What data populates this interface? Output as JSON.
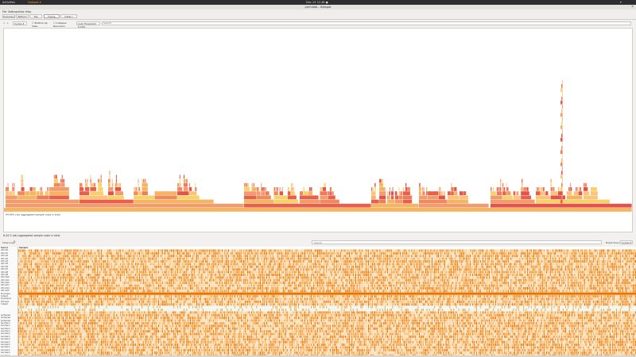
{
  "topbar": {
    "activities": "Activities",
    "app": "Hotspot ▾",
    "clock": "Dec 15 12:48 ●"
  },
  "window": {
    "title": "perf.data - Hotspot"
  },
  "menu": [
    "File",
    "Settings",
    "View",
    "Help"
  ],
  "tabs": [
    "Summary",
    "Bottom Up",
    "Top Down",
    "Flame Graph",
    "Caller / Callee"
  ],
  "active_tab": "Flame Graph",
  "toolbar": {
    "metric": "Cycles",
    "bottom_up": "Bottom Up View",
    "collapse": "Collapse Recursion",
    "cost_threshold": "Cost Threshold: 0.10%",
    "search_placeholder": "Search"
  },
  "flame": {
    "root_label": "94.49% (ok) aggregated sample costs in total",
    "colors": [
      "#e8604c",
      "#f08a5d",
      "#f5b461",
      "#f7d26a",
      "#ee7b5a",
      "#f39c6b",
      "#ffc27a",
      "#e4524a"
    ]
  },
  "timeline": {
    "info": "8.44 G (ok) aggregated sample costs in total",
    "time_line_label": "Time Line",
    "search_placeholder": "Search",
    "event_source_label": "Event Source:",
    "event_source_value": "Cycles",
    "header_source": "Source",
    "header_samples": "Samples",
    "rows": [
      "CPU #0",
      "CPU #1",
      "CPU #2",
      "CPU #3",
      "CPU #4",
      "CPU #5",
      "CPU #6",
      "CPU #7",
      "CPU #8",
      "CPU #9",
      "CPU #10",
      "CPU #11",
      "CPU #12",
      "CPU #13",
      "CPU #14",
      "CPU #15",
      "Processes",
      "hotspot",
      "threadpool",
      "QThread",
      "hotspot",
      "",
      "",
      "",
      "perfparser",
      "perfparser",
      "perfparser",
      "kworker/u",
      "kworker/u",
      "kworker/u",
      "kworker/u",
      "kworker/u",
      "kworker/u",
      "kworker/u",
      "kworker/u",
      "kworker/u",
      "kworker/u",
      "kworker/u",
      "kworker/u",
      "kworker/u"
    ],
    "heat_colors": [
      "#f08a1e",
      "#f6a545",
      "#e97400",
      "#fbd08e"
    ]
  }
}
